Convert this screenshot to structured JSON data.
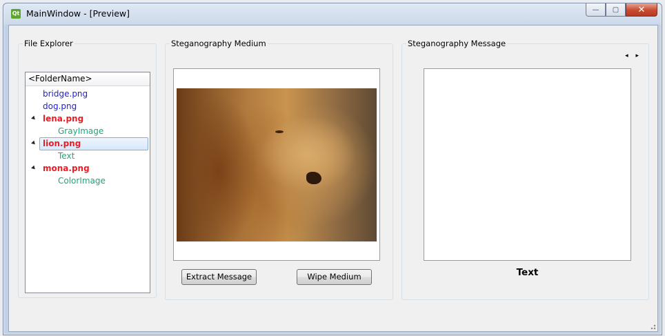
{
  "window": {
    "title": "MainWindow - [Preview]",
    "app_icon_text": "Qt",
    "caption": {
      "minimize": "—",
      "maximize": "▢",
      "close": "✕"
    }
  },
  "file_explorer": {
    "title": "File Explorer",
    "header": "<FolderName>",
    "items": [
      {
        "label": "bridge.png",
        "kind": "file",
        "expanded": false
      },
      {
        "label": "dog.png",
        "kind": "file",
        "expanded": false
      },
      {
        "label": "lena.png",
        "kind": "file-bold",
        "expanded": true
      },
      {
        "label": "GrayImage",
        "kind": "child"
      },
      {
        "label": "lion.png",
        "kind": "file-bold",
        "expanded": true,
        "selected": true
      },
      {
        "label": "Text",
        "kind": "child"
      },
      {
        "label": "mona.png",
        "kind": "file-bold",
        "expanded": true
      },
      {
        "label": "ColorImage",
        "kind": "child"
      }
    ]
  },
  "medium": {
    "title": "Steganography Medium",
    "image": "lion-photo",
    "extract_label": "Extract Message",
    "wipe_label": "Wipe Medium"
  },
  "message": {
    "title": "Steganography Message",
    "nav_arrows": "◂ ▸",
    "type_label": "Text"
  },
  "colors": {
    "file_blue": "#1b1ed6",
    "file_red": "#ec1c24",
    "child_green": "#20a37d"
  }
}
